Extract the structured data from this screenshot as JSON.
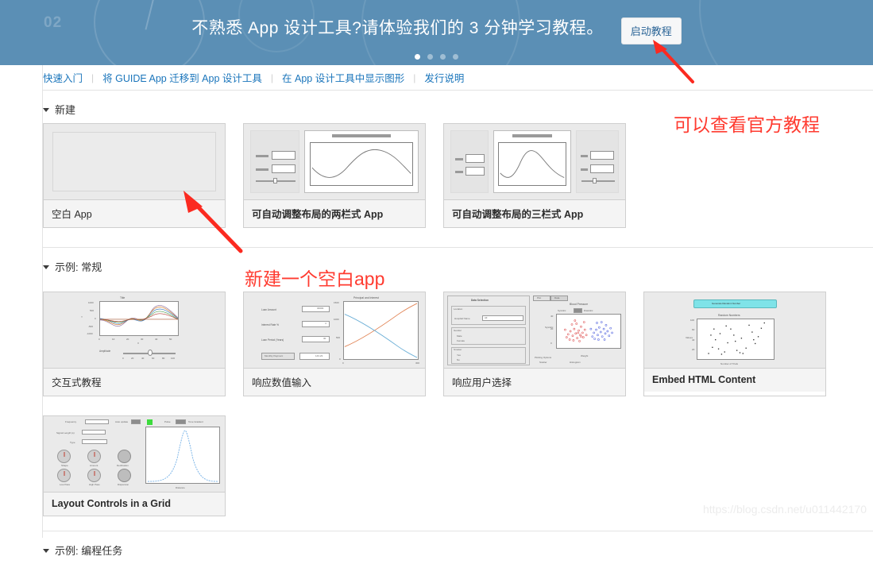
{
  "banner": {
    "message": "不熟悉 App 设计工具?请体验我们的 3 分钟学习教程。",
    "button_label": "启动教程",
    "bg_color": "#5b8fb5",
    "decor_number": "02",
    "carousel_dots": 4,
    "carousel_active_index": 0
  },
  "linkbar": {
    "links": [
      {
        "label": "快速入门"
      },
      {
        "label": "将 GUIDE App 迁移到 App 设计工具"
      },
      {
        "label": "在 App 设计工具中显示图形"
      },
      {
        "label": "发行说明"
      }
    ],
    "separator": "|",
    "link_color": "#1a75bb"
  },
  "sections": [
    {
      "title": "新建",
      "expanded": true,
      "cards": [
        {
          "label": "空白 App",
          "thumb": "blank-app-thumb",
          "bold": false
        },
        {
          "label": "可自动调整布局的两栏式 App",
          "thumb": "two-column-template-thumb",
          "bold": true
        },
        {
          "label": "可自动调整布局的三栏式 App",
          "thumb": "three-column-template-thumb",
          "bold": true
        }
      ]
    },
    {
      "title": "示例: 常规",
      "expanded": true,
      "cards": [
        {
          "label": "交互式教程",
          "thumb": "interactive-tutorial-thumb",
          "bold": false
        },
        {
          "label": "响应数值输入",
          "thumb": "numeric-input-thumb",
          "bold": false
        },
        {
          "label": "响应用户选择",
          "thumb": "user-selection-thumb",
          "bold": false
        },
        {
          "label": "Embed HTML Content",
          "thumb": "embed-html-thumb",
          "bold": true
        },
        {
          "label": "Layout Controls in a Grid",
          "thumb": "grid-layout-thumb",
          "bold": true
        }
      ]
    },
    {
      "title": "示例: 编程任务",
      "expanded": true,
      "cards": []
    }
  ],
  "thumbnails": {
    "interactive_tutorial": {
      "plot_title": "Title",
      "xlabel": "X",
      "ylabel": "Y",
      "yticks": [
        "1000",
        "500",
        "0",
        "-500",
        "-1000"
      ],
      "xticks": [
        "0",
        "10",
        "20",
        "30",
        "40",
        "50"
      ],
      "slider_label": "Amplitude",
      "slider_ticks": [
        "0",
        "20",
        "40",
        "60",
        "80",
        "100"
      ]
    },
    "numeric_input": {
      "plot_title": "Principal and Interest",
      "fields": [
        {
          "label": "Loan Amount",
          "value": "30000"
        },
        {
          "label": "Interest Rate %",
          "value": "4"
        },
        {
          "label": "Loan Period (Years)",
          "value": "30"
        }
      ],
      "button_label": "Monthly Payment",
      "result_value": "143.23",
      "yticks": [
        "1500",
        "1000",
        "500",
        "0"
      ],
      "xticks": [
        "0",
        "50",
        "100",
        "150",
        "200",
        "250",
        "300"
      ]
    },
    "user_selection": {
      "panel_title": "Data Selection",
      "groups": [
        {
          "title": "Location",
          "label": "Hospital Name",
          "value": "All"
        },
        {
          "title": "Gender",
          "items": [
            "Male",
            "Female"
          ]
        },
        {
          "title": "Smoker",
          "items": [
            "Yes",
            "No"
          ]
        }
      ],
      "tabs": [
        "Plot",
        "Data"
      ],
      "plot_title": "Blood Pressure",
      "toggle_left": "Systolic",
      "toggle_right": "Diastolic",
      "xlabel": "Weight",
      "ylabel": "Systolic",
      "plotting_options_title": "Plotting Options",
      "plotting_options": [
        "Scatter",
        "Histogram"
      ]
    },
    "embed_html": {
      "button_label": "Generate Random Number",
      "button_color": "#7fe3e8",
      "plot_title": "Random Numbers",
      "xlabel": "Number of Trials",
      "ylabel": "Values"
    },
    "grid_layout": {
      "knob_labels": [
        "Shape",
        "Amount",
        "Declination",
        "Low Pass",
        "High Pass",
        "Dispersion"
      ],
      "field_labels": [
        "Frequency",
        "Signal Length (s)",
        "Type"
      ],
      "toggle_labels": [
        "Auto update",
        "Pulse",
        "Tone Gradient"
      ],
      "xlabel": "Distance"
    }
  },
  "annotations": [
    {
      "text": "可以查看官方教程",
      "color": "#ff3b30"
    },
    {
      "text": "新建一个空白app",
      "color": "#ff3b30"
    }
  ],
  "watermark": "https://blog.csdn.net/u011442170"
}
